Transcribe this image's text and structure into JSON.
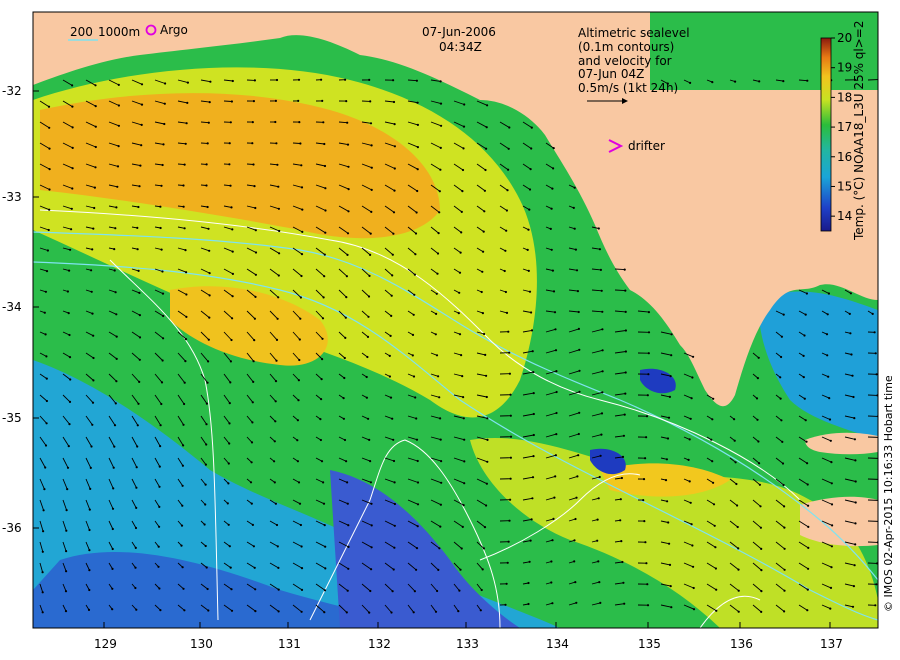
{
  "map": {
    "date": "07-Jun-2006",
    "time": "04:34Z",
    "legend_isobath_200": "200",
    "legend_isobath_1000": "1000m",
    "legend_argo": "Argo",
    "altimetry_lines": [
      "Altimetric sealevel",
      "(0.1m contours)",
      "and velocity for",
      "07-Jun 04Z",
      "0.5m/s (1kt 24h)"
    ],
    "drifter_label": "drifter",
    "colorbar_label": "Temp. (°C) NOAA18_L3U 25% ql>=2",
    "colorbar_ticks": [
      "20",
      "19",
      "18",
      "17",
      "16",
      "15",
      "14"
    ],
    "colorbar_range": [
      13.5,
      20
    ],
    "credit": "© IMOS 02-Apr-2015 10:16:33 Hobart time",
    "lat_ticks": [
      "-32",
      "-33",
      "-34",
      "-35",
      "-36"
    ],
    "lon_ticks": [
      "129",
      "130",
      "131",
      "132",
      "133",
      "134",
      "135",
      "136",
      "137"
    ],
    "colors": {
      "land": "#f9c8a2",
      "cold": "#1b3fbf",
      "cool": "#16a6d6",
      "mid": "#25b94a",
      "warm": "#d7e622",
      "hot": "#f0a623",
      "argo_marker": "#e000e0",
      "drifter_marker": "#e000e0",
      "isobath": "#7fe3f0",
      "contour": "#ffffff"
    }
  }
}
